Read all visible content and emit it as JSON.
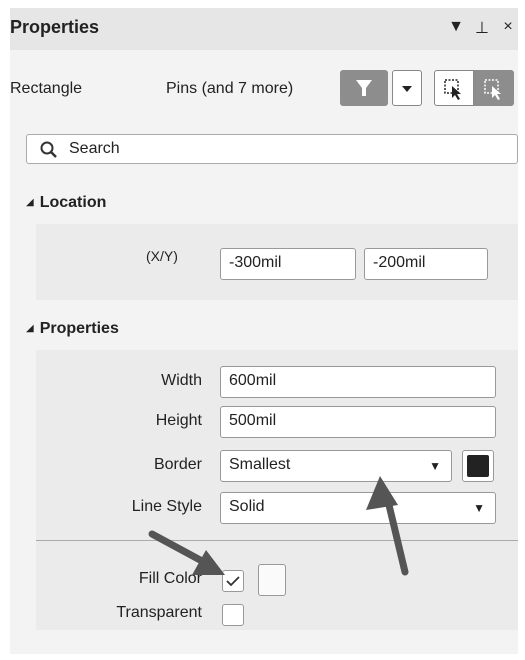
{
  "panel": {
    "title": "Properties",
    "titlebar_icons": [
      "dropdown-icon",
      "pin-icon",
      "close-icon"
    ],
    "titlebar_glyphs": [
      "▼",
      "⊥",
      "×"
    ]
  },
  "selection": {
    "object_type": "Rectangle",
    "filter_text": "Pins (and 7 more)"
  },
  "search": {
    "placeholder": "Search"
  },
  "location": {
    "header": "Location",
    "xy_label": "(X/Y)",
    "x_value": "-300mil",
    "y_value": "-200mil"
  },
  "properties": {
    "header": "Properties",
    "width_label": "Width",
    "width_value": "600mil",
    "height_label": "Height",
    "height_value": "500mil",
    "border_label": "Border",
    "border_value": "Smallest",
    "border_color": "#222222",
    "line_style_label": "Line Style",
    "line_style_value": "Solid",
    "fill_color_label": "Fill Color",
    "fill_checked": true,
    "fill_color": "#fafafa",
    "transparent_label": "Transparent",
    "transparent_checked": false
  },
  "colors": {
    "accent_button": "#8d8d8d",
    "arrow_annotation": "#555555"
  }
}
